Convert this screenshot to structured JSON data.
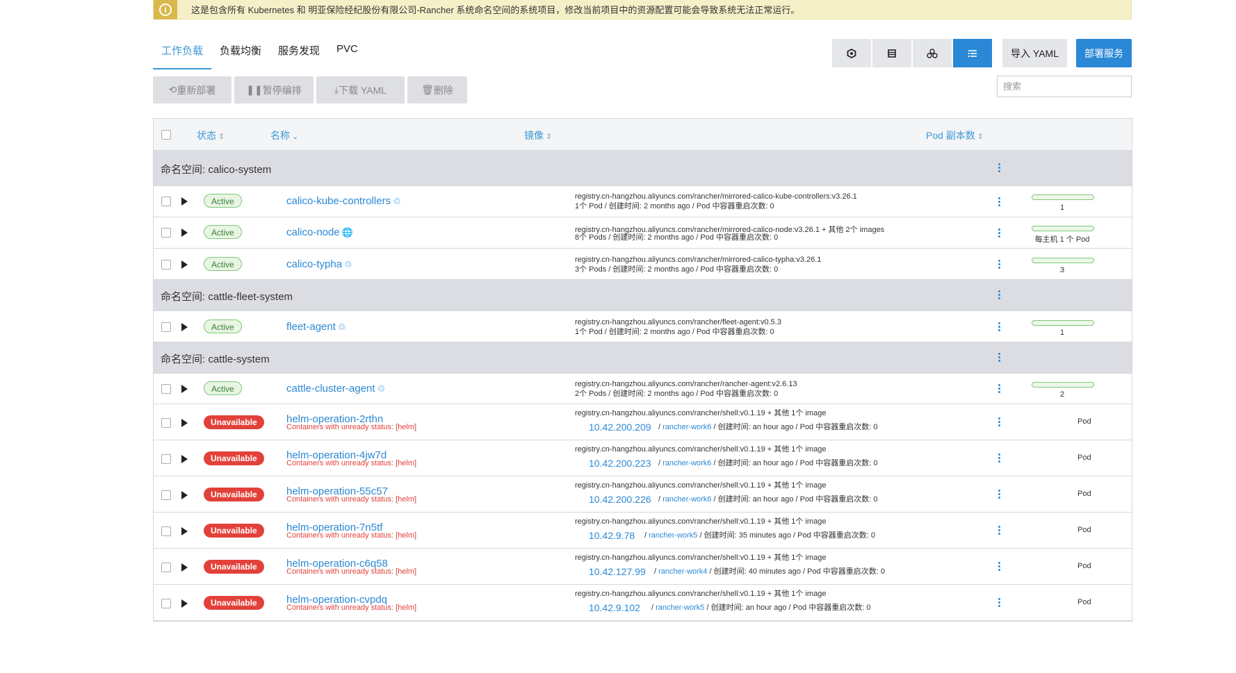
{
  "banner": {
    "text": "这是包含所有 Kubernetes 和 明亚保险经纪股份有限公司-Rancher 系统命名空间的系统项目，修改当前项目中的资源配置可能会导致系统无法正常运行。"
  },
  "tabs": [
    "工作负载",
    "负载均衡",
    "服务发现",
    "PVC"
  ],
  "buttons": {
    "import_yaml": "导入 YAML",
    "deploy": "部署服务"
  },
  "actions": {
    "redeploy": "重新部署",
    "pause": "暂停编排",
    "download": "下载 YAML",
    "delete": "删除"
  },
  "search": {
    "placeholder": "搜索"
  },
  "table": {
    "headers": {
      "state": "状态",
      "name": "名称",
      "image": "镜像",
      "pods": "Pod 副本数"
    },
    "groups": [
      {
        "label": "命名空间: calico-system"
      },
      {
        "label": "命名空间: cattle-fleet-system"
      },
      {
        "label": "命名空间: cattle-system"
      }
    ],
    "rows": [
      {
        "state": "Active",
        "name": "calico-kube-controllers",
        "image": "registry.cn-hangzhou.aliyuncs.com/rancher/mirrored-calico-kube-controllers:v3.26.1",
        "detail": "1个 Pod / 创建时间: 2 months ago / Pod 中容器重启次数: 0",
        "pods": "1",
        "progress": 1.0
      },
      {
        "state": "Active",
        "name": "calico-node",
        "image": "registry.cn-hangzhou.aliyuncs.com/rancher/mirrored-calico-node:v3.26.1 + 其他 2个 images",
        "detail": "8个 Pods / 创建时间: 2 months ago / Pod 中容器重启次数: 0",
        "pods": "每主机 1 个 Pod",
        "progress": 1.0
      },
      {
        "state": "Active",
        "name": "calico-typha",
        "image": "registry.cn-hangzhou.aliyuncs.com/rancher/mirrored-calico-typha:v3.26.1",
        "detail": "3个 Pods / 创建时间: 2 months ago / Pod 中容器重启次数: 0",
        "pods": "3",
        "progress": 1.0
      },
      {
        "state": "Active",
        "name": "fleet-agent",
        "image": "registry.cn-hangzhou.aliyuncs.com/rancher/fleet-agent:v0.5.3",
        "detail": "1个 Pod / 创建时间: 2 months ago / Pod 中容器重启次数: 0",
        "pods": "1",
        "progress": 1.0
      },
      {
        "state": "Active",
        "name": "cattle-cluster-agent",
        "image": "registry.cn-hangzhou.aliyuncs.com/rancher/rancher-agent:v2.6.13",
        "detail": "2个 Pods / 创建时间: 2 months ago / Pod 中容器重启次数: 0",
        "pods": "2",
        "progress": 1.0
      },
      {
        "state": "Unavailable",
        "name": "helm-operation-2rthn",
        "sub": "Containers with unready status: [helm]",
        "image": "registry.cn-hangzhou.aliyuncs.com/rancher/shell:v0.1.19 + 其他 1个 image",
        "ip": "10.42.200.209",
        "node": "rancher-work6",
        "detail": " / 创建时间: an hour ago / Pod 中容器重启次数: 0",
        "pods": "Pod"
      },
      {
        "state": "Unavailable",
        "name": "helm-operation-4jw7d",
        "sub": "Containers with unready status: [helm]",
        "image": "registry.cn-hangzhou.aliyuncs.com/rancher/shell:v0.1.19 + 其他 1个 image",
        "ip": "10.42.200.223",
        "node": "rancher-work6",
        "detail": " / 创建时间: an hour ago / Pod 中容器重启次数: 0",
        "pods": "Pod"
      },
      {
        "state": "Unavailable",
        "name": "helm-operation-55c57",
        "sub": "Containers with unready status: [helm]",
        "image": "registry.cn-hangzhou.aliyuncs.com/rancher/shell:v0.1.19 + 其他 1个 image",
        "ip": "10.42.200.226",
        "node": "rancher-work6",
        "detail": " / 创建时间: an hour ago / Pod 中容器重启次数: 0",
        "pods": "Pod"
      },
      {
        "state": "Unavailable",
        "name": "helm-operation-7n5tf",
        "sub": "Containers with unready status: [helm]",
        "image": "registry.cn-hangzhou.aliyuncs.com/rancher/shell:v0.1.19 + 其他 1个 image",
        "ip": "10.42.9.78",
        "node": "rancher-work5",
        "detail": " / 创建时间: 35 minutes ago / Pod 中容器重启次数: 0",
        "pods": "Pod"
      },
      {
        "state": "Unavailable",
        "name": "helm-operation-c6q58",
        "sub": "Containers with unready status: [helm]",
        "image": "registry.cn-hangzhou.aliyuncs.com/rancher/shell:v0.1.19 + 其他 1个 image",
        "ip": "10.42.127.99",
        "node": "rancher-work4",
        "detail": " / 创建时间: 40 minutes ago / Pod 中容器重启次数: 0",
        "pods": "Pod"
      },
      {
        "state": "Unavailable",
        "name": "helm-operation-cvpdq",
        "sub": "Containers with unready status: [helm]",
        "image": "registry.cn-hangzhou.aliyuncs.com/rancher/shell:v0.1.19 + 其他 1个 image",
        "ip": "10.42.9.102",
        "node": "rancher-work5",
        "detail": " / 创建时间: an hour ago / Pod 中容器重启次数: 0",
        "pods": "Pod"
      }
    ]
  },
  "icons": {
    "warning": "info-circle-icon",
    "workload": "workload-icon",
    "daemonset": "globe-icon"
  },
  "colors": {
    "accent": "#2a88d6",
    "active_green": "#3a7f34",
    "unavailable_red": "#e2413a",
    "banner_bg": "#f6f0c8"
  }
}
